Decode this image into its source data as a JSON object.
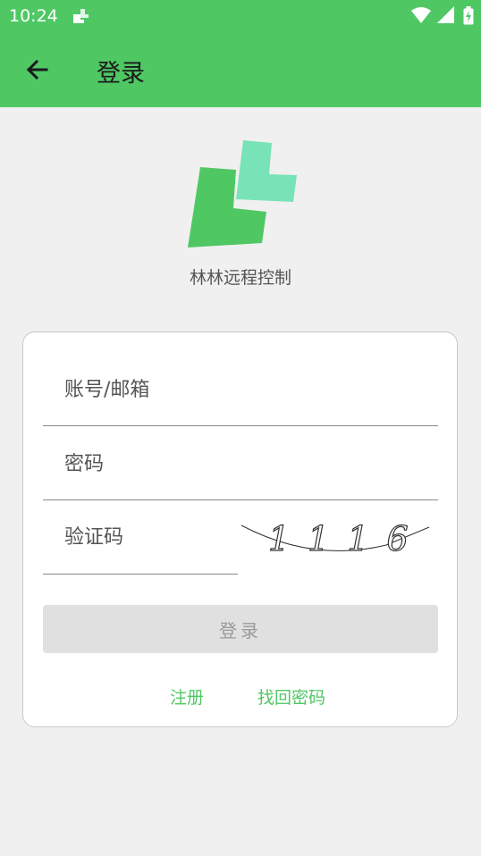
{
  "status_bar": {
    "time": "10:24",
    "icons": [
      "app-notification-icon",
      "wifi-icon",
      "signal-icon",
      "battery-icon"
    ]
  },
  "app_bar": {
    "title": "登录",
    "back_icon": "arrow-left-icon"
  },
  "brand": {
    "app_name": "林林远程控制",
    "logo_colors": {
      "dark": "#4fc864",
      "light": "#78e3b7"
    }
  },
  "form": {
    "account_placeholder": "账号/邮箱",
    "password_placeholder": "密码",
    "captcha_placeholder": "验证码",
    "captcha_text": "1116",
    "login_label": "登录",
    "register_link": "注册",
    "forgot_password_link": "找回密码"
  },
  "colors": {
    "primary": "#4fc864",
    "background": "#f0f0f0",
    "button_disabled": "#e0e0e0"
  }
}
